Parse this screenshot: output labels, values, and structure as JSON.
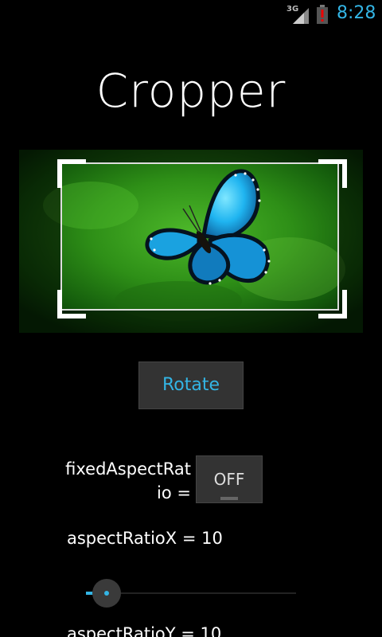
{
  "status_bar": {
    "network": "3G",
    "time": "8:28",
    "signal_icon": "signal-icon",
    "battery_icon": "battery-alert-icon",
    "time_color": "#33b5e5"
  },
  "app": {
    "title": "Cropper"
  },
  "crop": {
    "image": "butterfly on green background",
    "frame_color": "#dddddd"
  },
  "controls": {
    "rotate_label": "Rotate",
    "fixed_aspect_label": "fixedAspectRatio =",
    "fixed_aspect_value": "OFF",
    "aspect_ratio_x_label": "aspectRatioX = 10",
    "aspect_ratio_x_value": 10,
    "aspect_ratio_y_label": "aspectRatioY = 10",
    "accent_color": "#33b5e5"
  }
}
